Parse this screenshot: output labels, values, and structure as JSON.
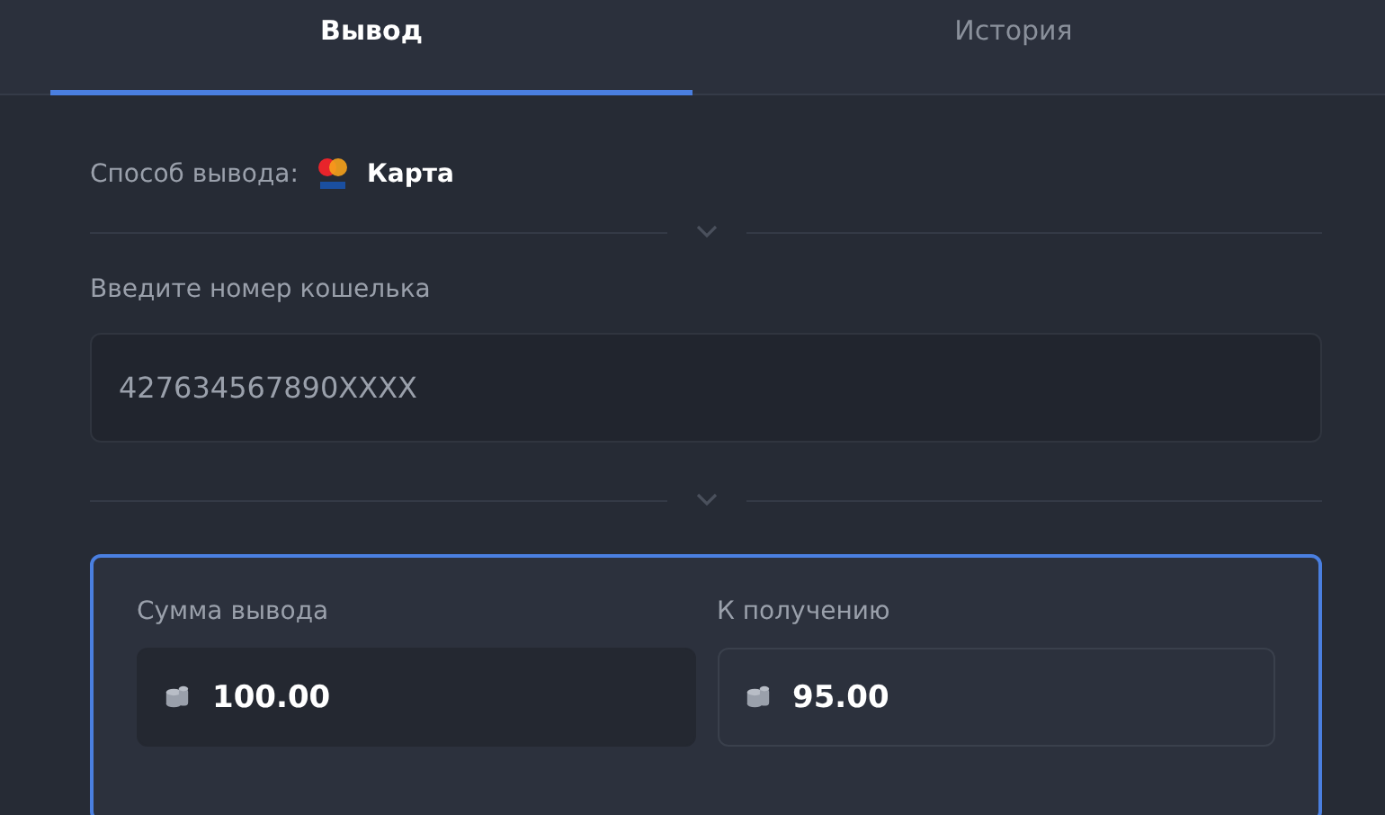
{
  "tabs": [
    {
      "label": "Вывод",
      "selected": true
    },
    {
      "label": "История",
      "selected": false
    }
  ],
  "method": {
    "label": "Способ вывода:",
    "value": "Карта"
  },
  "wallet": {
    "label": "Введите номер кошелька",
    "placeholder": "427634567890XXXX"
  },
  "amounts": [
    {
      "label": "Сумма вывода",
      "value": "100.00",
      "kind": "input"
    },
    {
      "label": "К получению",
      "value": "95.00",
      "kind": "readonly"
    }
  ]
}
